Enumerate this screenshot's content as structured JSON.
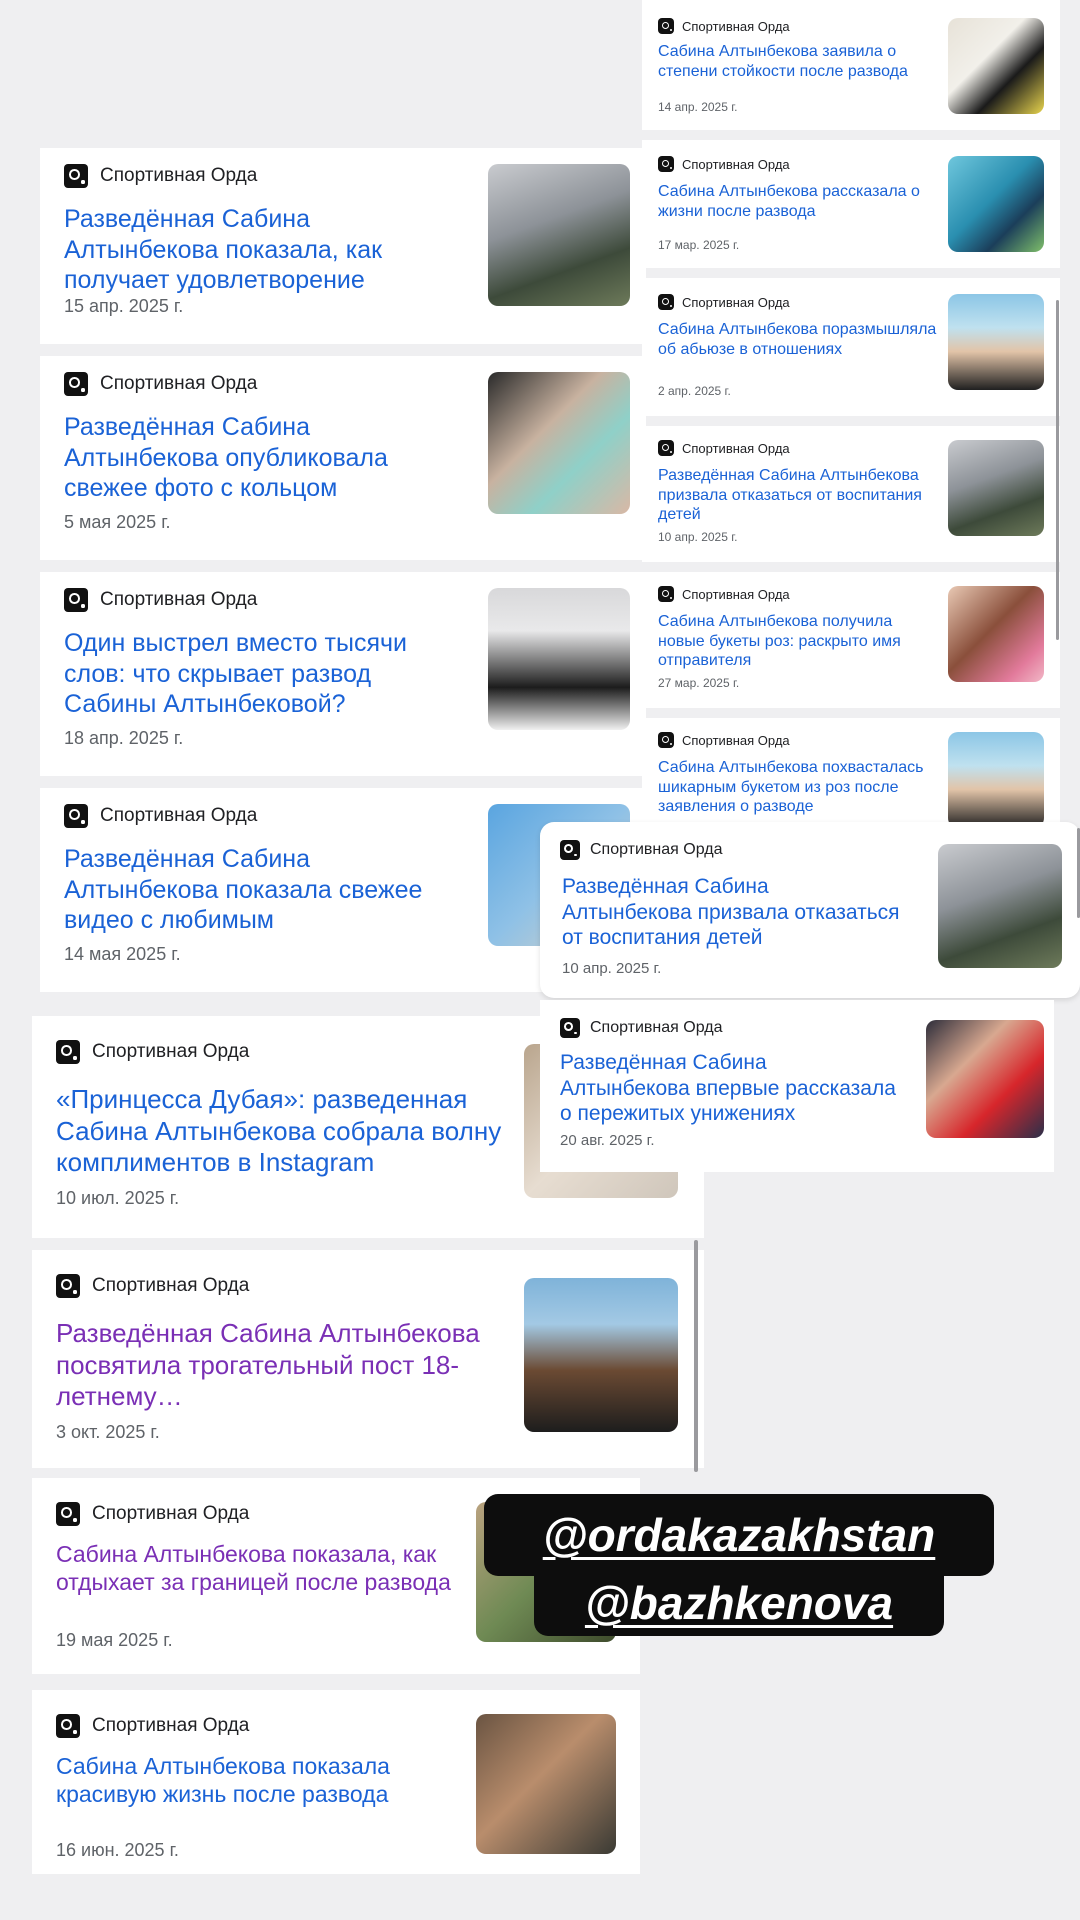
{
  "source_name": "Спортивная Орда",
  "left_cards": [
    {
      "title": "Разведённая Сабина Алтынбекова показала, как получает удовлетворение",
      "date": "15 апр. 2025 г.",
      "visited": false
    },
    {
      "title": "Разведённая Сабина Алтынбекова опубликовала свежее фото с кольцом",
      "date": "5 мая 2025 г.",
      "visited": false
    },
    {
      "title": "Один выстрел вместо тысячи слов: что скрывает развод Сабины Алтынбековой?",
      "date": "18 апр. 2025 г.",
      "visited": false
    },
    {
      "title": "Разведённая Сабина Алтынбекова показала свежее видео с любимым",
      "date": "14 мая 2025 г.",
      "visited": false
    },
    {
      "title": "«Принцесса Дубая»: разведенная Сабина Алтынбекова собрала волну комплиментов в Instagram",
      "date": "10 июл. 2025 г.",
      "visited": false
    },
    {
      "title": "Разведённая Сабина Алтынбекова посвятила трогательный пост 18-летнему…",
      "date": "3 окт. 2025 г.",
      "visited": true
    },
    {
      "title": "Сабина Алтынбекова показала, как отдыхает за границей после развода",
      "date": "19 мая 2025 г.",
      "visited": true
    },
    {
      "title": "Сабина Алтынбекова показала красивую жизнь после развода",
      "date": "16 июн. 2025 г.",
      "visited": false
    }
  ],
  "right_cards": [
    {
      "title": "Сабина Алтынбекова заявила о степени стойкости после развода",
      "date": "14 апр. 2025 г."
    },
    {
      "title": "Сабина Алтынбекова рассказала о жизни после развода",
      "date": "17 мар. 2025 г."
    },
    {
      "title": "Сабина Алтынбекова поразмышляла об абьюзе в отношениях",
      "date": "2 апр. 2025 г."
    },
    {
      "title": "Разведённая Сабина Алтынбекова призвала отказаться от воспитания детей",
      "date": "10 апр. 2025 г."
    },
    {
      "title": "Сабина Алтынбекова получила новые букеты роз: раскрыто имя отправителя",
      "date": "27 мар. 2025 г."
    },
    {
      "title": "Сабина Алтынбекова похвасталась шикарным букетом из роз после заявления о разводе",
      "date": ""
    }
  ],
  "overlay_cards": [
    {
      "title": "Разведённая Сабина Алтынбекова призвала отказаться от воспитания детей",
      "date": "10 апр. 2025 г."
    },
    {
      "title": "Разведённая Сабина Алтынбекова впервые рассказала о пережитых унижениях",
      "date": "20 авг. 2025 г."
    }
  ],
  "tags": [
    "@ordakazakhstan",
    "@bazhkenova"
  ],
  "colors": {
    "link": "#1a62d6",
    "visited": "#7a2fb5",
    "background": "#efeff1"
  }
}
